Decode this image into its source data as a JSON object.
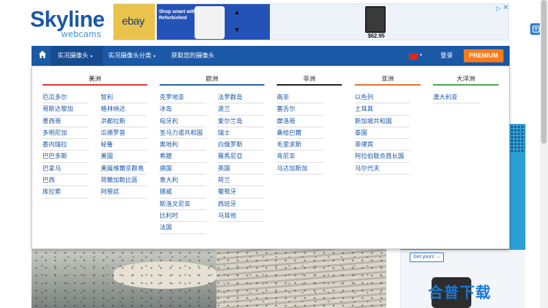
{
  "logo": {
    "word1": "Skyline",
    "word2": "webcams"
  },
  "top_ad": {
    "brand": "ebay",
    "promo_text": "Shop smart with eBay Refurbished",
    "price": "$62.95",
    "arrow_up": "▲",
    "arrow_down": "▼",
    "adchoice": "▷",
    "close": "✕"
  },
  "nav": {
    "live_cams": "实况摄像头",
    "categories": "实况摄像头分类",
    "get_your_cam": "获取您的摄像头",
    "login": "登录",
    "premium": "PREMIUM",
    "caret": "▾"
  },
  "colors": {
    "nav_bg": "#1b58a6",
    "premium": "#ff7a1a",
    "americas_bar": "#d9282b",
    "europe_bar": "#1b58a6",
    "africa_bar": "#111111",
    "asia_bar": "#e06a20",
    "oceania_bar": "#43a047"
  },
  "menu": {
    "continents": {
      "americas": "美洲",
      "europe": "欧洲",
      "africa": "非洲",
      "asia": "亚洲",
      "oceania": "大洋洲"
    },
    "americas_col1": [
      "厄瓜多尔",
      "哥斯达黎加",
      "墨西哥",
      "多明尼加",
      "委内瑞拉",
      "巴巴多斯",
      "巴拿马",
      "巴西",
      "库拉索"
    ],
    "americas_col2": [
      "智利",
      "格林纳达",
      "洪都拉斯",
      "瓜德罗普",
      "秘鲁",
      "美国",
      "美属维爾京群島",
      "荷蘭加勒比區",
      "阿根廷"
    ],
    "europe_col1": [
      "克罗地亚",
      "冰岛",
      "匈牙利",
      "圣马力诺共和国",
      "奥地利",
      "希腊",
      "德国",
      "意大利",
      "挪威",
      "斯洛文尼亚",
      "比利时",
      "法国"
    ],
    "europe_col2": [
      "法罗群岛",
      "波兰",
      "爱尔兰岛",
      "瑞士",
      "白俄罗斯",
      "羅馬尼亞",
      "英国",
      "荷兰",
      "葡萄牙",
      "西班牙",
      "马耳他"
    ],
    "africa": [
      "南非",
      "塞舌尔",
      "摩洛哥",
      "桑给巴爾",
      "毛里求斯",
      "肯尼亚",
      "马达加斯加"
    ],
    "asia": [
      "以色列",
      "土耳其",
      "新加坡共和国",
      "泰国",
      "菲律宾",
      "阿拉伯联合酋长国",
      "马尔代夫"
    ],
    "oceania": [
      "澳大利亚"
    ]
  },
  "side_ad": {
    "cta": "Get yours →"
  },
  "watermark": "合普下载"
}
